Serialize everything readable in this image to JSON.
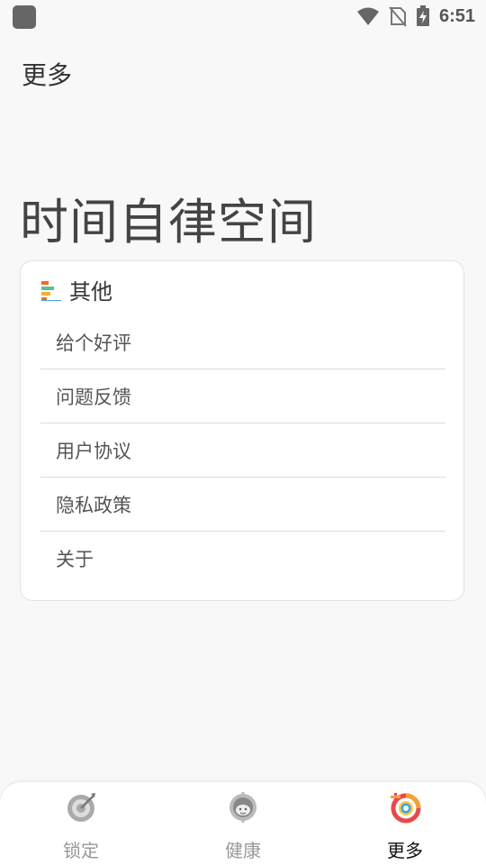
{
  "status_bar": {
    "time": "6:51",
    "icons": [
      "wifi-icon",
      "no-sim-icon",
      "battery-charging-icon"
    ]
  },
  "header": {
    "title": "更多"
  },
  "hero": {
    "title": "时间自律空间"
  },
  "card": {
    "icon": "bar-list-icon",
    "title": "其他",
    "items": [
      {
        "label": "给个好评"
      },
      {
        "label": "问题反馈"
      },
      {
        "label": "用户协议"
      },
      {
        "label": "隐私政策"
      },
      {
        "label": "关于"
      }
    ]
  },
  "bottom_nav": {
    "items": [
      {
        "label": "锁定",
        "icon": "target-icon",
        "active": false
      },
      {
        "label": "健康",
        "icon": "health-face-icon",
        "active": false
      },
      {
        "label": "更多",
        "icon": "colorful-ring-icon",
        "active": true
      }
    ]
  },
  "colors": {
    "background": "#f8f8f8",
    "card": "#ffffff",
    "active_text": "#111111",
    "inactive_text": "#999999"
  }
}
